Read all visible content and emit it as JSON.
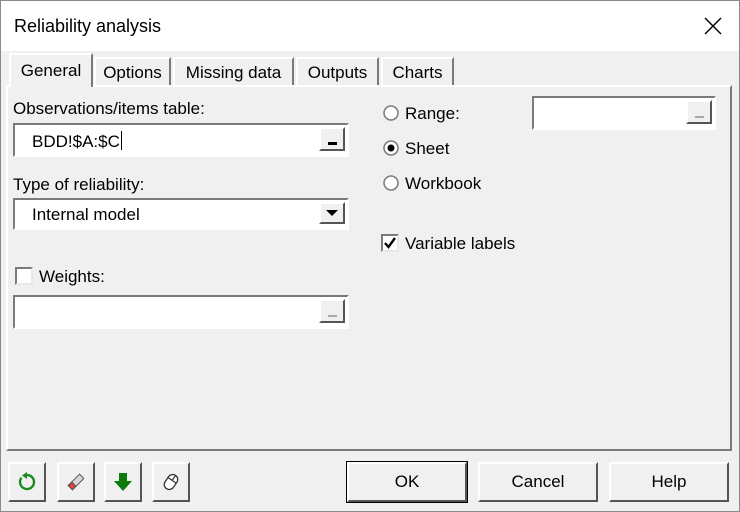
{
  "window": {
    "title": "Reliability analysis"
  },
  "tabs": [
    {
      "label": "General",
      "active": true
    },
    {
      "label": "Options",
      "active": false
    },
    {
      "label": "Missing data",
      "active": false
    },
    {
      "label": "Outputs",
      "active": false
    },
    {
      "label": "Charts",
      "active": false
    }
  ],
  "general": {
    "observations_label": "Observations/items table:",
    "observations_value": "BDD!$A:$C",
    "reliability_type_label": "Type of reliability:",
    "reliability_type_value": "Internal model",
    "weights_label": "Weights:",
    "weights_checked": false,
    "weights_value": "",
    "range_label": "Range:",
    "range_value": "",
    "sheet_label": "Sheet",
    "workbook_label": "Workbook",
    "output_selected": "Sheet",
    "variable_labels_label": "Variable labels",
    "variable_labels_checked": true
  },
  "buttons": {
    "ok": "OK",
    "cancel": "Cancel",
    "help": "Help"
  },
  "toolbar_icons": [
    "reset-icon",
    "eraser-icon",
    "down-arrow-icon",
    "mouse-icon"
  ],
  "colors": {
    "green_icon": "#1e8a1e",
    "dark_green_arrow": "#0a7a0a"
  }
}
